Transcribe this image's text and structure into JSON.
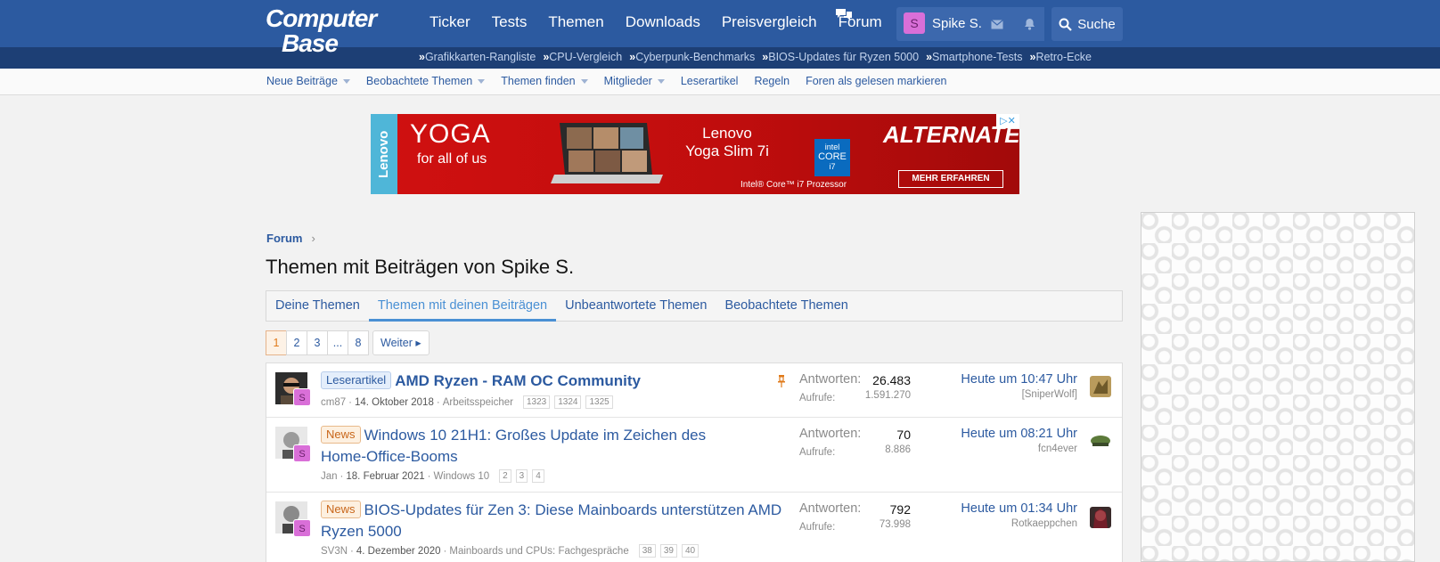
{
  "header": {
    "logo_line1": "Computer",
    "logo_line2": "Base",
    "nav": [
      "Ticker",
      "Tests",
      "Themen",
      "Downloads",
      "Preisvergleich",
      "Forum"
    ],
    "user_initial": "S",
    "username": "Spike S.",
    "search_label": "Suche",
    "quicklinks": [
      "Grafikkarten-Rangliste",
      "CPU-Vergleich",
      "Cyberpunk-Benchmarks",
      "BIOS-Updates für Ryzen 5000",
      "Smartphone-Tests",
      "Retro-Ecke"
    ],
    "quicklink_arrow": "»"
  },
  "subnav": {
    "items": [
      "Neue Beiträge",
      "Beobachtete Themen",
      "Themen finden",
      "Mitglieder",
      "Leserartikel",
      "Regeln",
      "Foren als gelesen markieren"
    ]
  },
  "ad": {
    "brand": "Lenovo",
    "yoga": "YOGA",
    "tagline": "for all of us",
    "model_line1": "Lenovo",
    "model_line2": "Yoga Slim 7i",
    "intel_line1": "intel",
    "intel_line2": "CORE",
    "intel_line3": "i7",
    "processor": "Intel® Core™ i7 Prozessor",
    "shop": "ALTERNATE",
    "cta": "MEHR ERFAHREN",
    "adchoice": "▷✕"
  },
  "breadcrumb": {
    "root": "Forum",
    "sep": "›"
  },
  "page_title": "Themen mit Beiträgen von Spike S.",
  "tabs": [
    "Deine Themen",
    "Themen mit deinen Beiträgen",
    "Unbeantwortete Themen",
    "Beobachtete Themen"
  ],
  "pager": {
    "pages": [
      "1",
      "2",
      "3",
      "...",
      "8"
    ],
    "current": "1",
    "next": "Weiter ▸"
  },
  "threads": [
    {
      "label": "Leserartikel",
      "title": "AMD Ryzen - RAM OC Community",
      "author": "cm87",
      "date": "14. Oktober 2018",
      "forum": "Arbeitsspeicher",
      "pages": [
        "1323",
        "1324",
        "1325"
      ],
      "replies_label": "Antworten:",
      "replies": "26.483",
      "views_label": "Aufrufe:",
      "views": "1.591.270",
      "last_time": "Heute um 10:47 Uhr",
      "last_user": "[SniperWolf]",
      "user_initial": "S"
    },
    {
      "label": "News",
      "title": "Windows 10 21H1: Großes Update im Zeichen des Home-Office-Booms",
      "author": "Jan",
      "date": "18. Februar 2021",
      "forum": "Windows 10",
      "pages": [
        "2",
        "3",
        "4"
      ],
      "replies_label": "Antworten:",
      "replies": "70",
      "views_label": "Aufrufe:",
      "views": "8.886",
      "last_time": "Heute um 08:21 Uhr",
      "last_user": "fcn4ever",
      "user_initial": "S"
    },
    {
      "label": "News",
      "title": "BIOS-Updates für Zen 3: Diese Mainboards unterstützen AMD Ryzen 5000",
      "author": "SV3N",
      "date": "4. Dezember 2020",
      "forum": "Mainboards und CPUs: Fachgespräche",
      "pages": [
        "38",
        "39",
        "40"
      ],
      "replies_label": "Antworten:",
      "replies": "792",
      "views_label": "Aufrufe:",
      "views": "73.998",
      "last_time": "Heute um 01:34 Uhr",
      "last_user": "Rotkaeppchen",
      "user_initial": "S"
    }
  ],
  "colors": {
    "brand": "#2c5aa0",
    "accent": "#4a90d4",
    "news": "#c8661a",
    "avatar_s": "#d96fd8"
  },
  "icons": {
    "chat": "chat-bubbles-icon",
    "mail": "envelope-icon",
    "bell": "bell-icon",
    "search": "search-icon",
    "pin": "pin-icon"
  }
}
